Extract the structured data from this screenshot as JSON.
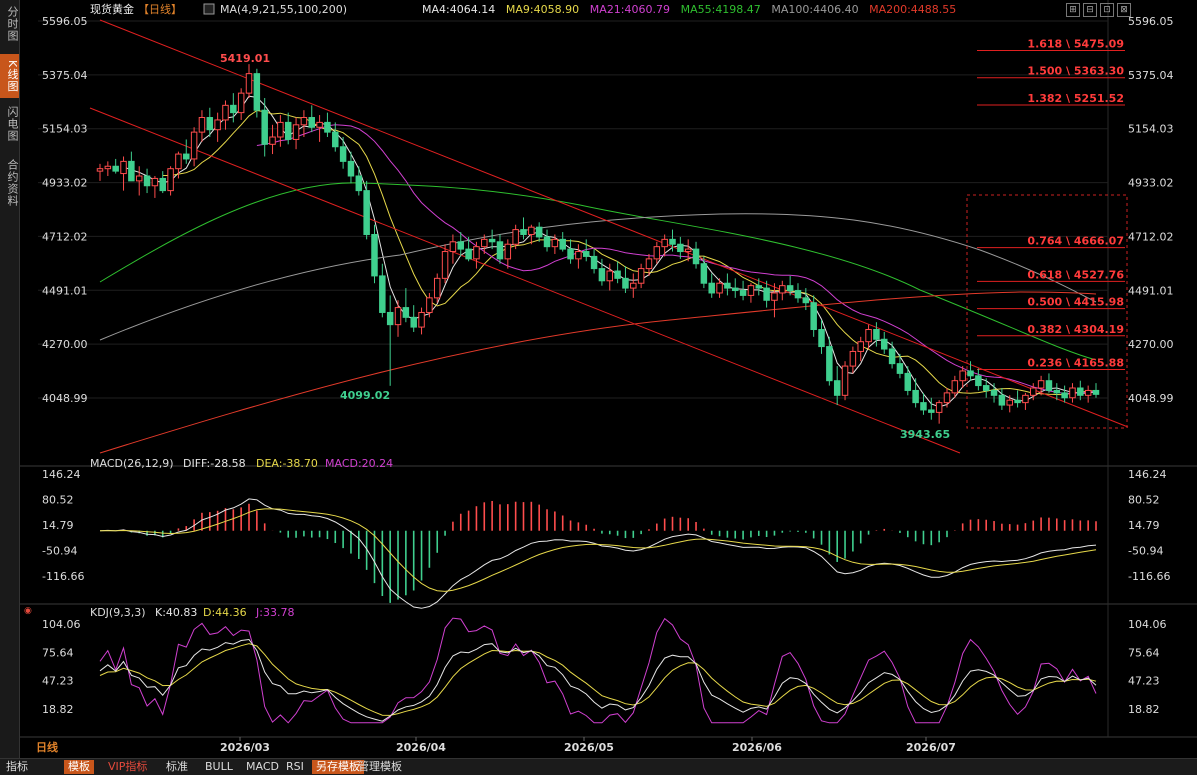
{
  "sidebar": [
    {
      "label": "分时图",
      "active": false
    },
    {
      "label": "K线图",
      "active": true
    },
    {
      "label": "闪电图",
      "active": false
    },
    {
      "label": "合约资料",
      "active": false
    }
  ],
  "header": {
    "symbol": "现货黄金",
    "period": "【日线】",
    "ma_params": "MA(4,9,21,55,100,200)",
    "ma_labels": [
      {
        "text": "MA4:4064.14",
        "color": "#e6e6e6"
      },
      {
        "text": "MA9:4058.90",
        "color": "#e6d84a"
      },
      {
        "text": "MA21:4060.79",
        "color": "#d040d0"
      },
      {
        "text": "MA55:4198.47",
        "color": "#2fbf2f"
      },
      {
        "text": "MA100:4406.40",
        "color": "#9a9a9a"
      },
      {
        "text": "MA200:4488.55",
        "color": "#e23a2a"
      }
    ]
  },
  "price_axis": {
    "ticks": [
      "5596.05",
      "5375.04",
      "5154.03",
      "4933.02",
      "4712.02",
      "4491.01",
      "4270.00",
      "4048.99"
    ]
  },
  "macd_panel": {
    "label": "MACD(26,12,9)",
    "diff": "DIFF:-28.58",
    "dea": "DEA:-38.70",
    "macd": "MACD:20.24",
    "ticks": [
      "146.24",
      "80.52",
      "14.79",
      "-50.94",
      "-116.66"
    ]
  },
  "kdj_panel": {
    "label": "KDJ(9,3,3)",
    "k": "K:40.83",
    "d": "D:44.36",
    "j": "J:33.78",
    "ticks": [
      "104.06",
      "75.64",
      "47.23",
      "18.82"
    ]
  },
  "date_axis": {
    "labels": [
      "2026/03",
      "2026/04",
      "2026/05",
      "2026/06",
      "2026/07"
    ]
  },
  "bottom_tabs": [
    {
      "label": "日线",
      "style": "title"
    },
    {
      "label": "指标",
      "style": "normal"
    },
    {
      "label": "模板",
      "style": "hl"
    },
    {
      "label": "VIP指标",
      "style": "red"
    },
    {
      "label": "标准",
      "style": "normal"
    },
    {
      "label": "BULL",
      "style": "normal"
    },
    {
      "label": "MACD",
      "style": "normal"
    },
    {
      "label": "RSI",
      "style": "normal"
    },
    {
      "label": "另存模板",
      "style": "hl"
    },
    {
      "label": "管理模板",
      "style": "normal"
    }
  ],
  "window_buttons": [
    "⊞",
    "⊟",
    "⊡",
    "⊠"
  ],
  "chart_data": {
    "type": "candlestick",
    "x_labels": [
      "2026/03",
      "2026/04",
      "2026/05",
      "2026/06",
      "2026/07"
    ],
    "ylim": [
      3943.65,
      5596.05
    ],
    "annotations": {
      "high": {
        "value": 5419.01,
        "label": "5419.01"
      },
      "low1": {
        "value": 4099.02,
        "label": "4099.02"
      },
      "low2": {
        "value": 3943.65,
        "label": "3943.65"
      }
    },
    "fib_levels": [
      {
        "label": "1.618 \\ 5475.09",
        "value": 5475.09
      },
      {
        "label": "1.500 \\ 5363.30",
        "value": 5363.3
      },
      {
        "label": "1.382 \\ 5251.52",
        "value": 5251.52
      },
      {
        "label": "0.764 \\ 4666.07",
        "value": 4666.07
      },
      {
        "label": "0.618 \\ 4527.76",
        "value": 4527.76
      },
      {
        "label": "0.500 \\ 4415.98",
        "value": 4415.98
      },
      {
        "label": "0.382 \\ 4304.19",
        "value": 4304.19
      },
      {
        "label": "0.236 \\ 4165.88",
        "value": 4165.88
      }
    ],
    "ohlc": [
      [
        4980,
        5010,
        4940,
        4990
      ],
      [
        4990,
        5020,
        4960,
        5000
      ],
      [
        5000,
        5030,
        4970,
        4980
      ],
      [
        4970,
        5040,
        4900,
        5020
      ],
      [
        5020,
        5060,
        4960,
        4940
      ],
      [
        4940,
        5000,
        4880,
        4960
      ],
      [
        4960,
        4990,
        4890,
        4920
      ],
      [
        4920,
        4960,
        4870,
        4950
      ],
      [
        4950,
        4980,
        4890,
        4900
      ],
      [
        4900,
        5000,
        4880,
        4990
      ],
      [
        4990,
        5060,
        4950,
        5050
      ],
      [
        5050,
        5110,
        5010,
        5030
      ],
      [
        5030,
        5160,
        5000,
        5140
      ],
      [
        5140,
        5230,
        5100,
        5200
      ],
      [
        5200,
        5240,
        5120,
        5150
      ],
      [
        5150,
        5220,
        5100,
        5190
      ],
      [
        5190,
        5270,
        5150,
        5250
      ],
      [
        5250,
        5300,
        5180,
        5220
      ],
      [
        5220,
        5320,
        5190,
        5300
      ],
      [
        5300,
        5419,
        5280,
        5380
      ],
      [
        5380,
        5400,
        5200,
        5230
      ],
      [
        5230,
        5280,
        5040,
        5090
      ],
      [
        5090,
        5170,
        5050,
        5120
      ],
      [
        5120,
        5210,
        5080,
        5180
      ],
      [
        5180,
        5220,
        5090,
        5110
      ],
      [
        5110,
        5200,
        5070,
        5170
      ],
      [
        5170,
        5230,
        5120,
        5200
      ],
      [
        5200,
        5250,
        5140,
        5160
      ],
      [
        5160,
        5210,
        5100,
        5180
      ],
      [
        5180,
        5220,
        5120,
        5140
      ],
      [
        5140,
        5180,
        5060,
        5080
      ],
      [
        5080,
        5120,
        4990,
        5020
      ],
      [
        5020,
        5060,
        4930,
        4960
      ],
      [
        4960,
        5000,
        4880,
        4900
      ],
      [
        4900,
        4940,
        4700,
        4720
      ],
      [
        4720,
        4760,
        4520,
        4550
      ],
      [
        4550,
        4600,
        4380,
        4400
      ],
      [
        4400,
        4470,
        4099,
        4350
      ],
      [
        4350,
        4450,
        4300,
        4420
      ],
      [
        4420,
        4500,
        4360,
        4380
      ],
      [
        4380,
        4430,
        4320,
        4340
      ],
      [
        4340,
        4420,
        4310,
        4400
      ],
      [
        4400,
        4480,
        4380,
        4460
      ],
      [
        4460,
        4560,
        4440,
        4540
      ],
      [
        4540,
        4680,
        4520,
        4650
      ],
      [
        4650,
        4720,
        4600,
        4690
      ],
      [
        4690,
        4730,
        4630,
        4660
      ],
      [
        4660,
        4710,
        4610,
        4620
      ],
      [
        4620,
        4690,
        4580,
        4670
      ],
      [
        4670,
        4720,
        4640,
        4700
      ],
      [
        4700,
        4740,
        4660,
        4690
      ],
      [
        4690,
        4720,
        4600,
        4620
      ],
      [
        4620,
        4700,
        4580,
        4680
      ],
      [
        4680,
        4760,
        4660,
        4740
      ],
      [
        4740,
        4790,
        4700,
        4720
      ],
      [
        4720,
        4760,
        4680,
        4750
      ],
      [
        4750,
        4770,
        4690,
        4710
      ],
      [
        4710,
        4740,
        4650,
        4670
      ],
      [
        4670,
        4720,
        4640,
        4700
      ],
      [
        4700,
        4730,
        4650,
        4660
      ],
      [
        4660,
        4700,
        4600,
        4620
      ],
      [
        4620,
        4680,
        4580,
        4650
      ],
      [
        4650,
        4700,
        4610,
        4630
      ],
      [
        4630,
        4660,
        4560,
        4580
      ],
      [
        4580,
        4620,
        4510,
        4530
      ],
      [
        4530,
        4600,
        4490,
        4570
      ],
      [
        4570,
        4610,
        4520,
        4540
      ],
      [
        4540,
        4590,
        4480,
        4500
      ],
      [
        4500,
        4560,
        4460,
        4520
      ],
      [
        4520,
        4600,
        4500,
        4580
      ],
      [
        4580,
        4640,
        4550,
        4620
      ],
      [
        4620,
        4690,
        4600,
        4670
      ],
      [
        4670,
        4720,
        4630,
        4700
      ],
      [
        4700,
        4740,
        4650,
        4680
      ],
      [
        4680,
        4710,
        4620,
        4650
      ],
      [
        4650,
        4700,
        4610,
        4660
      ],
      [
        4660,
        4690,
        4580,
        4600
      ],
      [
        4600,
        4630,
        4500,
        4520
      ],
      [
        4520,
        4560,
        4460,
        4480
      ],
      [
        4480,
        4540,
        4460,
        4520
      ],
      [
        4520,
        4560,
        4470,
        4500
      ],
      [
        4500,
        4540,
        4460,
        4490
      ],
      [
        4490,
        4530,
        4450,
        4470
      ],
      [
        4470,
        4520,
        4440,
        4510
      ],
      [
        4510,
        4540,
        4470,
        4500
      ],
      [
        4500,
        4530,
        4420,
        4450
      ],
      [
        4450,
        4520,
        4380,
        4480
      ],
      [
        4480,
        4530,
        4450,
        4510
      ],
      [
        4510,
        4550,
        4470,
        4490
      ],
      [
        4490,
        4520,
        4440,
        4460
      ],
      [
        4460,
        4500,
        4410,
        4440
      ],
      [
        4440,
        4470,
        4300,
        4330
      ],
      [
        4330,
        4370,
        4230,
        4260
      ],
      [
        4260,
        4300,
        4100,
        4120
      ],
      [
        4120,
        4180,
        4020,
        4060
      ],
      [
        4060,
        4200,
        4040,
        4180
      ],
      [
        4180,
        4260,
        4150,
        4240
      ],
      [
        4240,
        4300,
        4200,
        4280
      ],
      [
        4280,
        4350,
        4250,
        4330
      ],
      [
        4330,
        4360,
        4260,
        4290
      ],
      [
        4290,
        4320,
        4230,
        4250
      ],
      [
        4250,
        4280,
        4170,
        4190
      ],
      [
        4190,
        4230,
        4130,
        4150
      ],
      [
        4150,
        4180,
        4060,
        4080
      ],
      [
        4080,
        4130,
        4010,
        4030
      ],
      [
        4030,
        4070,
        3980,
        4000
      ],
      [
        4000,
        4050,
        3960,
        3990
      ],
      [
        3990,
        4040,
        3943.65,
        4030
      ],
      [
        4030,
        4090,
        4010,
        4070
      ],
      [
        4070,
        4140,
        4050,
        4120
      ],
      [
        4120,
        4180,
        4090,
        4160
      ],
      [
        4160,
        4200,
        4120,
        4140
      ],
      [
        4140,
        4170,
        4080,
        4100
      ],
      [
        4100,
        4130,
        4050,
        4080
      ],
      [
        4080,
        4110,
        4030,
        4060
      ],
      [
        4060,
        4090,
        4000,
        4020
      ],
      [
        4020,
        4060,
        3990,
        4040
      ],
      [
        4040,
        4080,
        4010,
        4030
      ],
      [
        4030,
        4070,
        4000,
        4060
      ],
      [
        4060,
        4110,
        4040,
        4090
      ],
      [
        4090,
        4140,
        4060,
        4120
      ],
      [
        4120,
        4150,
        4070,
        4080
      ],
      [
        4080,
        4110,
        4040,
        4070
      ],
      [
        4070,
        4100,
        4030,
        4050
      ],
      [
        4050,
        4110,
        4030,
        4090
      ],
      [
        4090,
        4120,
        4040,
        4060
      ],
      [
        4060,
        4100,
        4030,
        4080
      ],
      [
        4080,
        4110,
        4050,
        4064
      ]
    ]
  }
}
